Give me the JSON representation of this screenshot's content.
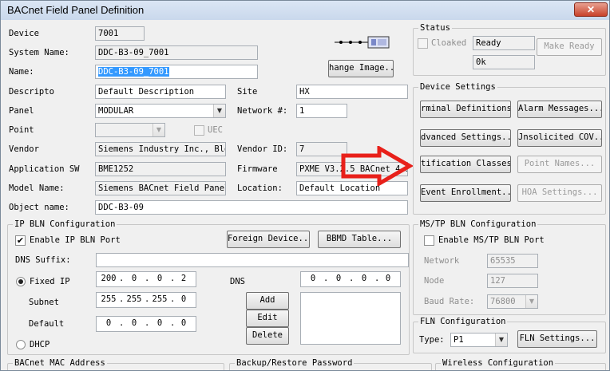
{
  "window": {
    "title": "BACnet Field Panel Definition",
    "close_glyph": "✕"
  },
  "general": {
    "device_label": "Device",
    "device_value": "7001",
    "system_name_label": "System Name:",
    "system_name_value": "DDC-B3-09_7001",
    "name_label": "Name:",
    "name_value": "DDC-B3-09_7001",
    "description_label": "Descripto",
    "description_value": "Default Description",
    "panel_label": "Panel",
    "panel_value": "MODULAR",
    "point_label": "Point",
    "uec_label": "UEC",
    "vendor_label": "Vendor",
    "vendor_value": "Siemens Industry Inc., Bldg",
    "application_sw_label": "Application SW",
    "application_sw_value": "BME1252",
    "model_name_label": "Model Name:",
    "model_name_value": "Siemens BACnet Field Panel",
    "object_name_label": "Object name:",
    "object_name_value": "DDC-B3-09",
    "site_label": "Site",
    "site_value": "HX",
    "network_label": "Network #:",
    "network_value": "1",
    "vendor_id_label": "Vendor ID:",
    "vendor_id_value": "7",
    "firmware_label": "Firmware",
    "firmware_value": "PXME V3.2.5 BACnet 4.3",
    "location_label": "Location:",
    "location_value": "Default Location",
    "change_image_label": "hange Image..",
    "device_icon": "field-panel-network-icon"
  },
  "status": {
    "caption": "Status",
    "cloaked_label": "Cloaked",
    "ready_value": "Ready",
    "ok_value": "0k",
    "make_ready_label": "Make Ready"
  },
  "device_settings": {
    "caption": "Device Settings",
    "terminal_definitions_label": "rminal Definitions.",
    "alarm_messages_label": "Alarm Messages...",
    "advanced_settings_label": "dvanced Settings..",
    "unsolicited_cov_label": "Jnsolicited COV...",
    "notification_classes_label": "tification Classes.",
    "point_names_label": "Point Names...",
    "event_enrollment_label": "Event Enrollment...",
    "hoa_settings_label": "HOA Settings..."
  },
  "ip_bln": {
    "caption": "IP BLN Configuration",
    "enable_label": "Enable IP BLN Port",
    "enable_checked": true,
    "foreign_device_label": "Foreign Device...",
    "bbmd_table_label": "BBMD Table...",
    "dns_suffix_label": "DNS Suffix:",
    "dns_suffix_value": "",
    "fixed_ip_label": "Fixed IP",
    "fixed_ip_value": [
      "200",
      "0",
      "0",
      "2"
    ],
    "subnet_label": "Subnet",
    "subnet_value": [
      "255",
      "255",
      "255",
      "0"
    ],
    "default_label": "Default",
    "default_value": [
      "0",
      "0",
      "0",
      "0"
    ],
    "dns_label": "DNS",
    "dns_value": [
      "0",
      "0",
      "0",
      "0"
    ],
    "add_label": "Add",
    "edit_label": "Edit",
    "delete_label": "Delete",
    "dhcp_label": "DHCP",
    "ip_separator": "."
  },
  "mstp_bln": {
    "caption": "MS/TP BLN Configuration",
    "enable_label": "Enable MS/TP BLN Port",
    "network_label": "Network",
    "network_value": "65535",
    "node_label": "Node",
    "node_value": "127",
    "baud_rate_label": "Baud Rate:",
    "baud_rate_value": "76800"
  },
  "fln": {
    "caption": "FLN Configuration",
    "type_label": "Type:",
    "type_value": "P1",
    "fln_settings_label": "FLN Settings..."
  },
  "bottom": {
    "bacnet_mac_label": "BACnet MAC Address",
    "backup_restore_label": "Backup/Restore Password",
    "wireless_label": "Wireless Configuration"
  },
  "annotation": {
    "arrow_color": "#e8201a"
  }
}
